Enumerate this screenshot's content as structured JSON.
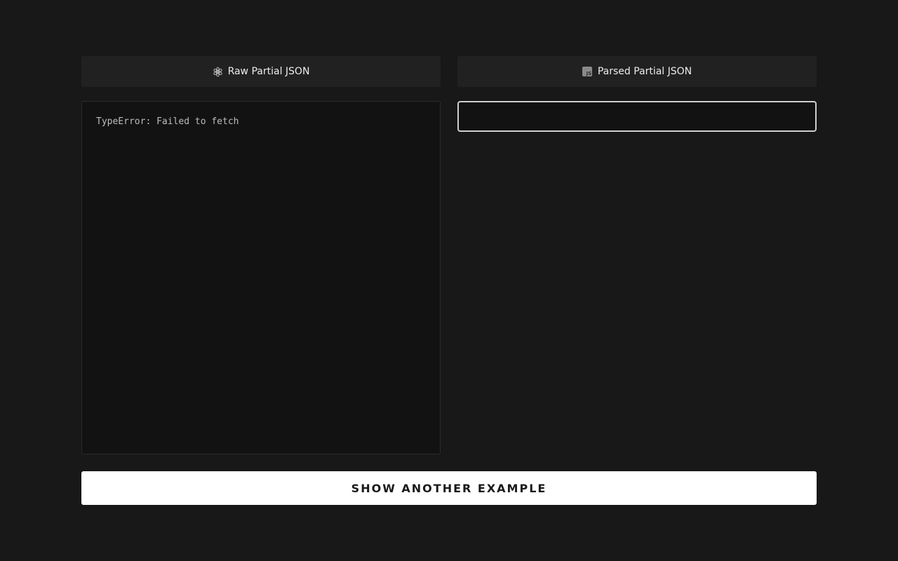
{
  "raw_column": {
    "header_label": "Raw Partial JSON",
    "icon": "openai-logo-icon",
    "content": "TypeError: Failed to fetch"
  },
  "parsed_column": {
    "header_label": "Parsed Partial JSON",
    "icon": "javascript-icon",
    "icon_text": "JS",
    "content": ""
  },
  "action": {
    "button_label": "SHOW ANOTHER EXAMPLE"
  },
  "colors": {
    "background": "#181818",
    "header_background": "#212121",
    "panel_background": "#121212",
    "button_background": "#ffffff",
    "button_text": "#1a1a1a"
  }
}
